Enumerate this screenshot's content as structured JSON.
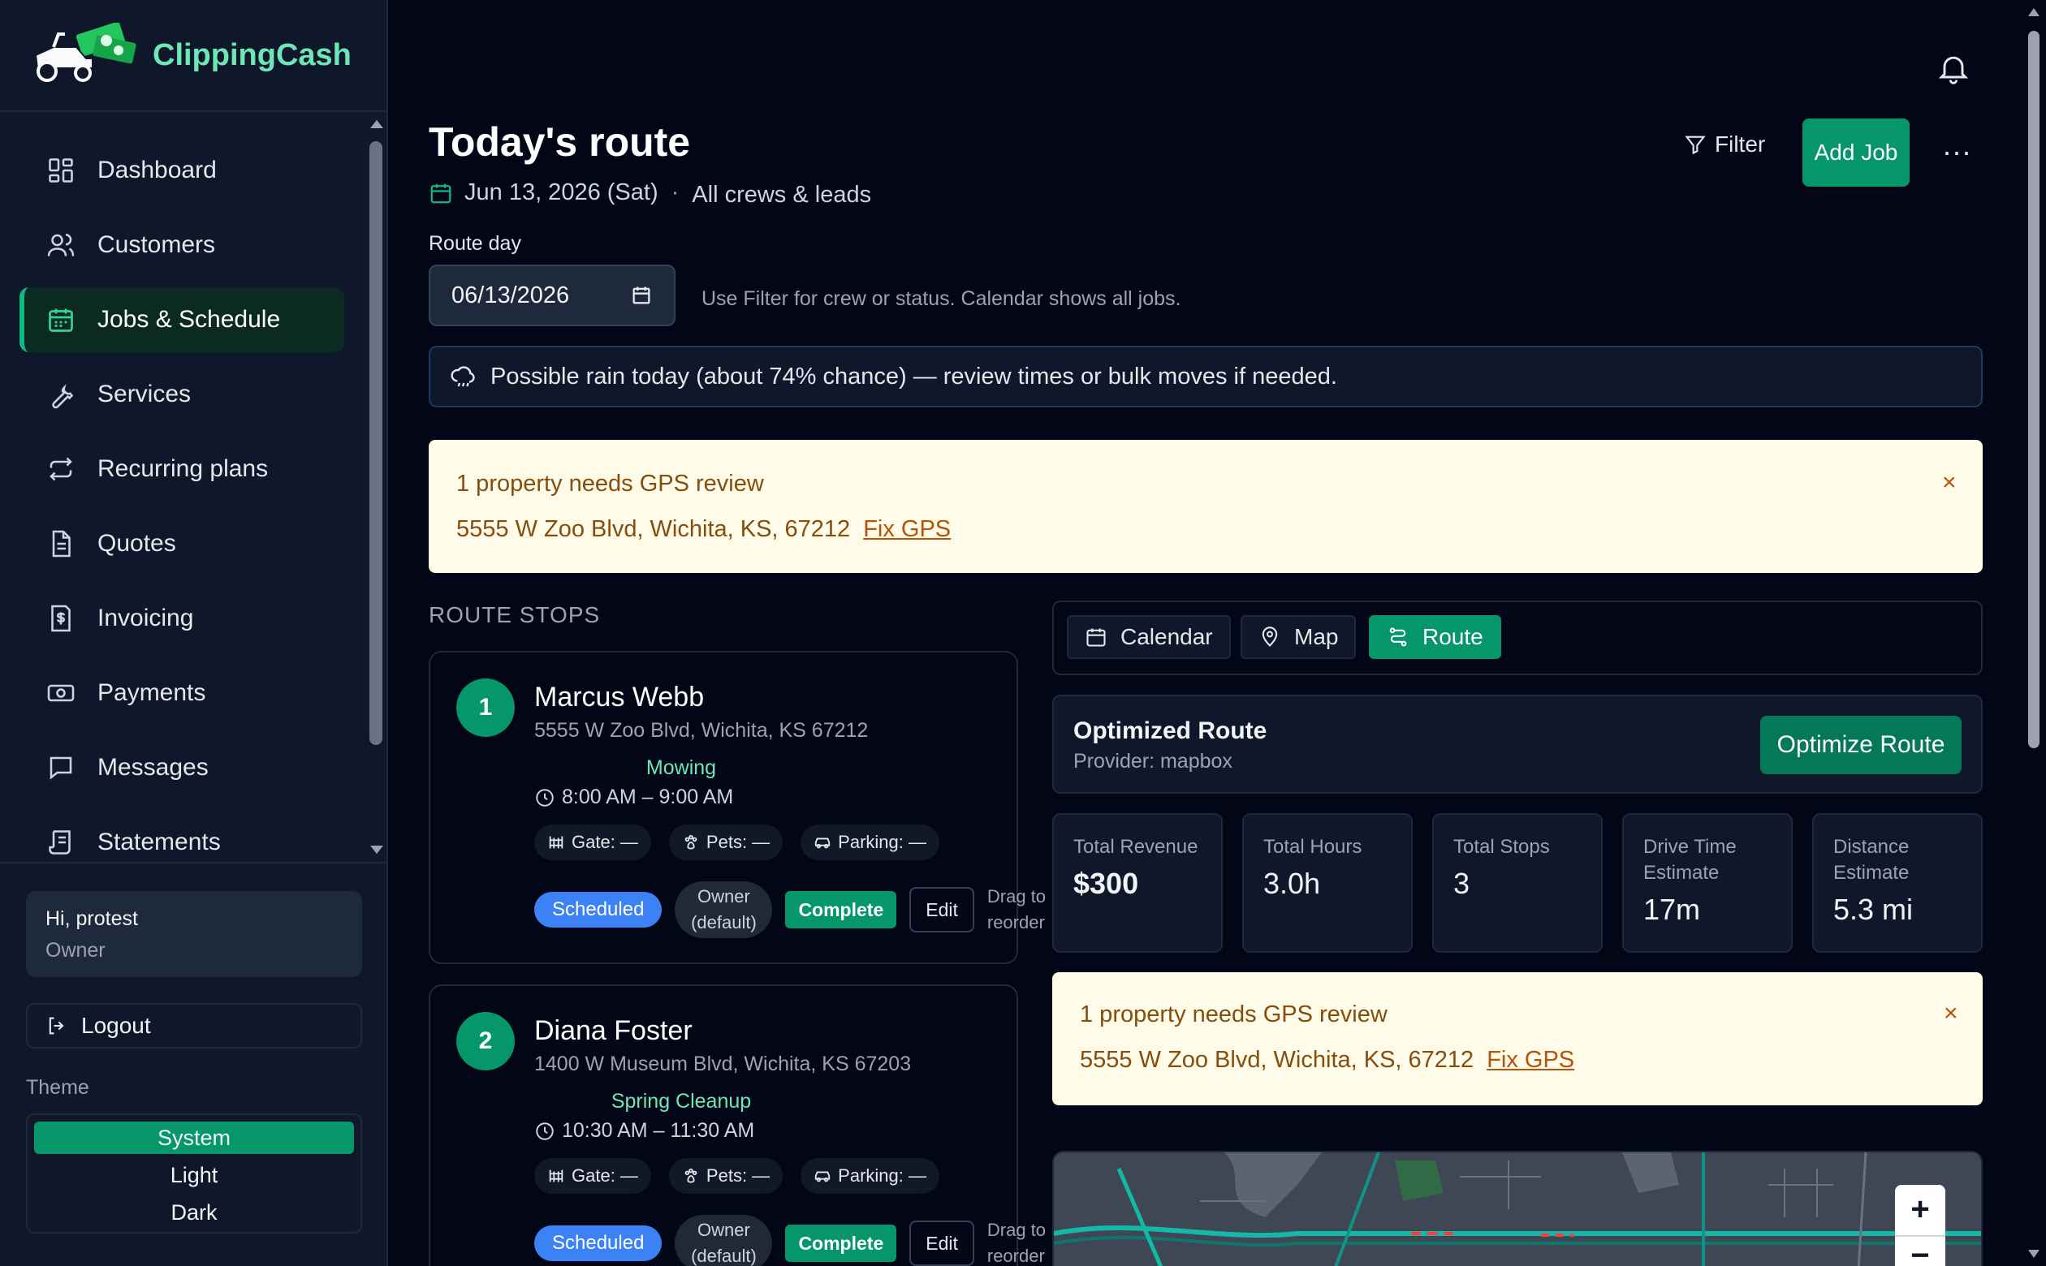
{
  "brand": {
    "name": "ClippingCash"
  },
  "sidebar": {
    "items": [
      {
        "label": "Dashboard",
        "icon": "dashboard-icon"
      },
      {
        "label": "Customers",
        "icon": "users-icon"
      },
      {
        "label": "Jobs & Schedule",
        "icon": "calendar-icon",
        "active": true
      },
      {
        "label": "Services",
        "icon": "wrench-icon"
      },
      {
        "label": "Recurring plans",
        "icon": "repeat-icon"
      },
      {
        "label": "Quotes",
        "icon": "document-icon"
      },
      {
        "label": "Invoicing",
        "icon": "invoice-dollar-icon"
      },
      {
        "label": "Payments",
        "icon": "cash-icon"
      },
      {
        "label": "Messages",
        "icon": "chat-icon"
      },
      {
        "label": "Statements",
        "icon": "statement-icon"
      }
    ],
    "user": {
      "greeting": "Hi, protest",
      "role": "Owner"
    },
    "logout": "Logout",
    "theme": {
      "label": "Theme",
      "options": [
        "System",
        "Light",
        "Dark"
      ],
      "selected": "System"
    }
  },
  "header": {
    "title": "Today's route",
    "date": "Jun 13, 2026 (Sat)",
    "separator": "·",
    "scope": "All crews & leads",
    "filter": "Filter",
    "add_job": "Add Job",
    "more": "···"
  },
  "route_day": {
    "label": "Route day",
    "value": "06/13/2026",
    "hint": "Use Filter for crew or status. Calendar shows all jobs."
  },
  "weather": {
    "text": "Possible rain today (about 74% chance) — review times or bulk moves if needed."
  },
  "gps_alert": {
    "title": "1 property needs GPS review",
    "address": "5555 W Zoo Blvd, Wichita, KS, 67212",
    "fix": "Fix GPS",
    "close": "×"
  },
  "route_stops": {
    "title": "ROUTE STOPS",
    "stops": [
      {
        "number": "1",
        "name": "Marcus Webb",
        "address": "5555 W Zoo Blvd, Wichita, KS 67212",
        "service": "Mowing",
        "time": "8:00 AM – 9:00 AM",
        "gate": "Gate: —",
        "pets": "Pets: —",
        "parking": "Parking: —",
        "status": "Scheduled",
        "owner_l1": "Owner",
        "owner_l2": "(default)",
        "complete": "Complete",
        "edit": "Edit",
        "drag_l1": "Drag to",
        "drag_l2": "reorder"
      },
      {
        "number": "2",
        "name": "Diana Foster",
        "address": "1400 W Museum Blvd, Wichita, KS 67203",
        "service": "Spring Cleanup",
        "time": "10:30 AM – 11:30 AM",
        "gate": "Gate: —",
        "pets": "Pets: —",
        "parking": "Parking: —",
        "status": "Scheduled",
        "owner_l1": "Owner",
        "owner_l2": "(default)",
        "complete": "Complete",
        "edit": "Edit",
        "drag_l1": "Drag to",
        "drag_l2": "reorder"
      }
    ]
  },
  "view_tabs": {
    "calendar": "Calendar",
    "map": "Map",
    "route": "Route",
    "active": "Route"
  },
  "optimized": {
    "title": "Optimized Route",
    "provider": "Provider: mapbox",
    "button": "Optimize Route"
  },
  "stats": [
    {
      "label": "Total Revenue",
      "value": "$300"
    },
    {
      "label": "Total Hours",
      "value": "3.0h"
    },
    {
      "label": "Total Stops",
      "value": "3"
    },
    {
      "label": "Drive Time Estimate",
      "value": "17m"
    },
    {
      "label": "Distance Estimate",
      "value": "5.3 mi"
    }
  ],
  "map": {
    "zoom_in": "+",
    "zoom_out": "−"
  },
  "colors": {
    "accent": "#059669",
    "brand": "#6ee7b7",
    "scheduled": "#3b82f6",
    "alert_bg": "#fefce8",
    "alert_text": "#854d0e"
  }
}
